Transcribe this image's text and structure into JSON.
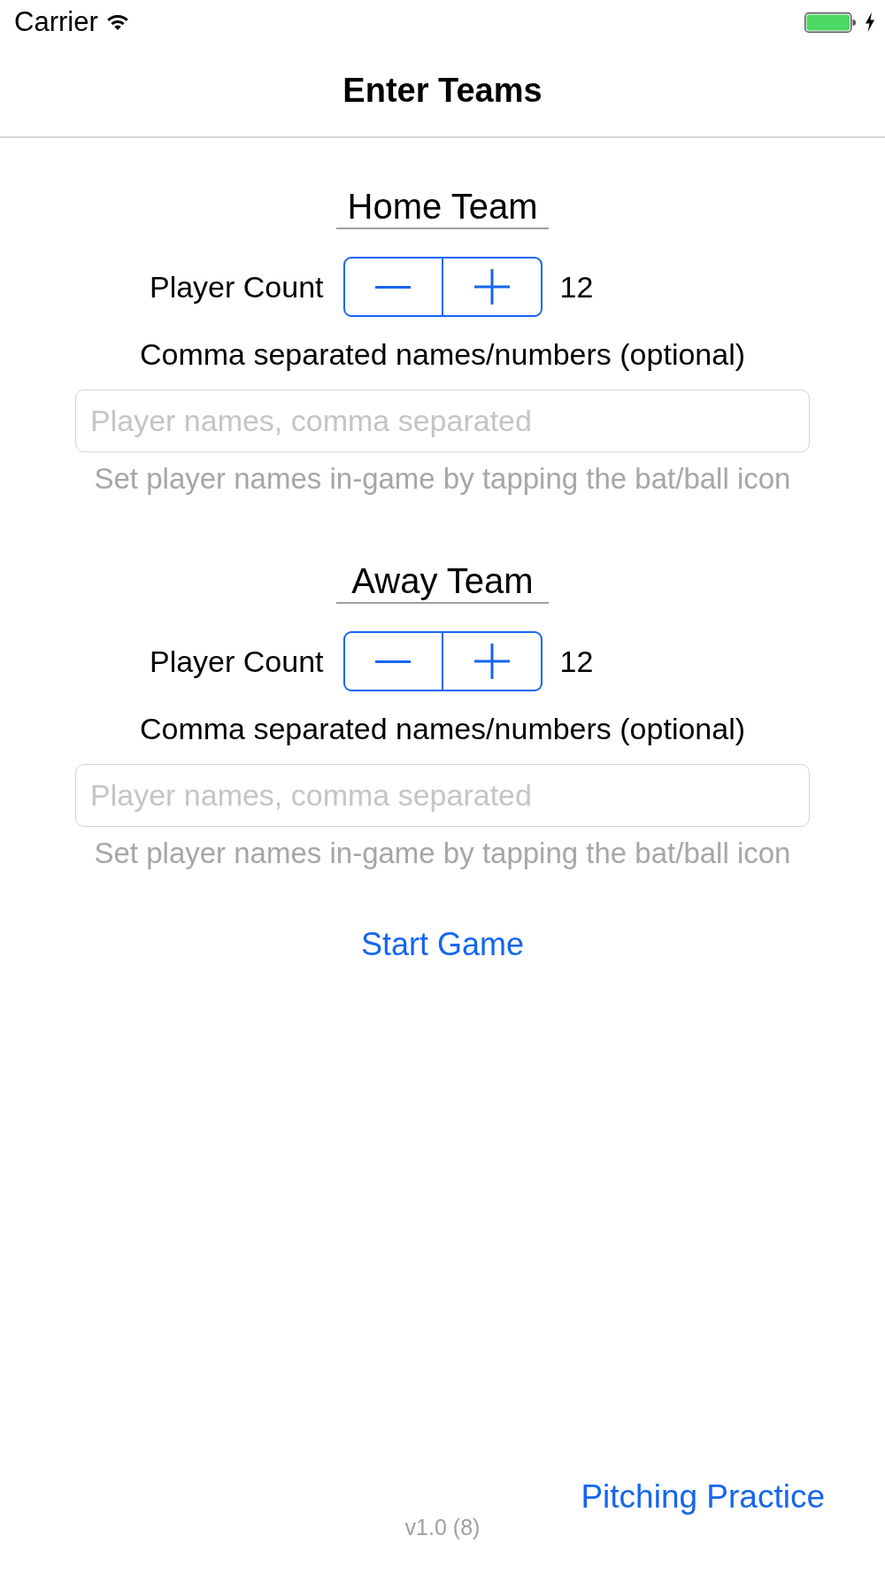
{
  "status_bar": {
    "carrier": "Carrier"
  },
  "nav_bar": {
    "title": "Enter Teams"
  },
  "teams": [
    {
      "heading": "Home Team",
      "count_label": "Player Count",
      "count": "12",
      "names_label": "Comma separated names/numbers (optional)",
      "names_field": {
        "placeholder": "Player names, comma separated"
      },
      "hint": "Set player names in-game by tapping the bat/ball icon"
    },
    {
      "heading": "Away Team",
      "count_label": "Player Count",
      "count": "12",
      "names_label": "Comma separated names/numbers (optional)",
      "names_field": {
        "placeholder": "Player names, comma separated"
      },
      "hint": "Set player names in-game by tapping the bat/ball icon"
    }
  ],
  "start_button": "Start Game",
  "pitching_button": "Pitching Practice",
  "version": "v1.0 (8)"
}
